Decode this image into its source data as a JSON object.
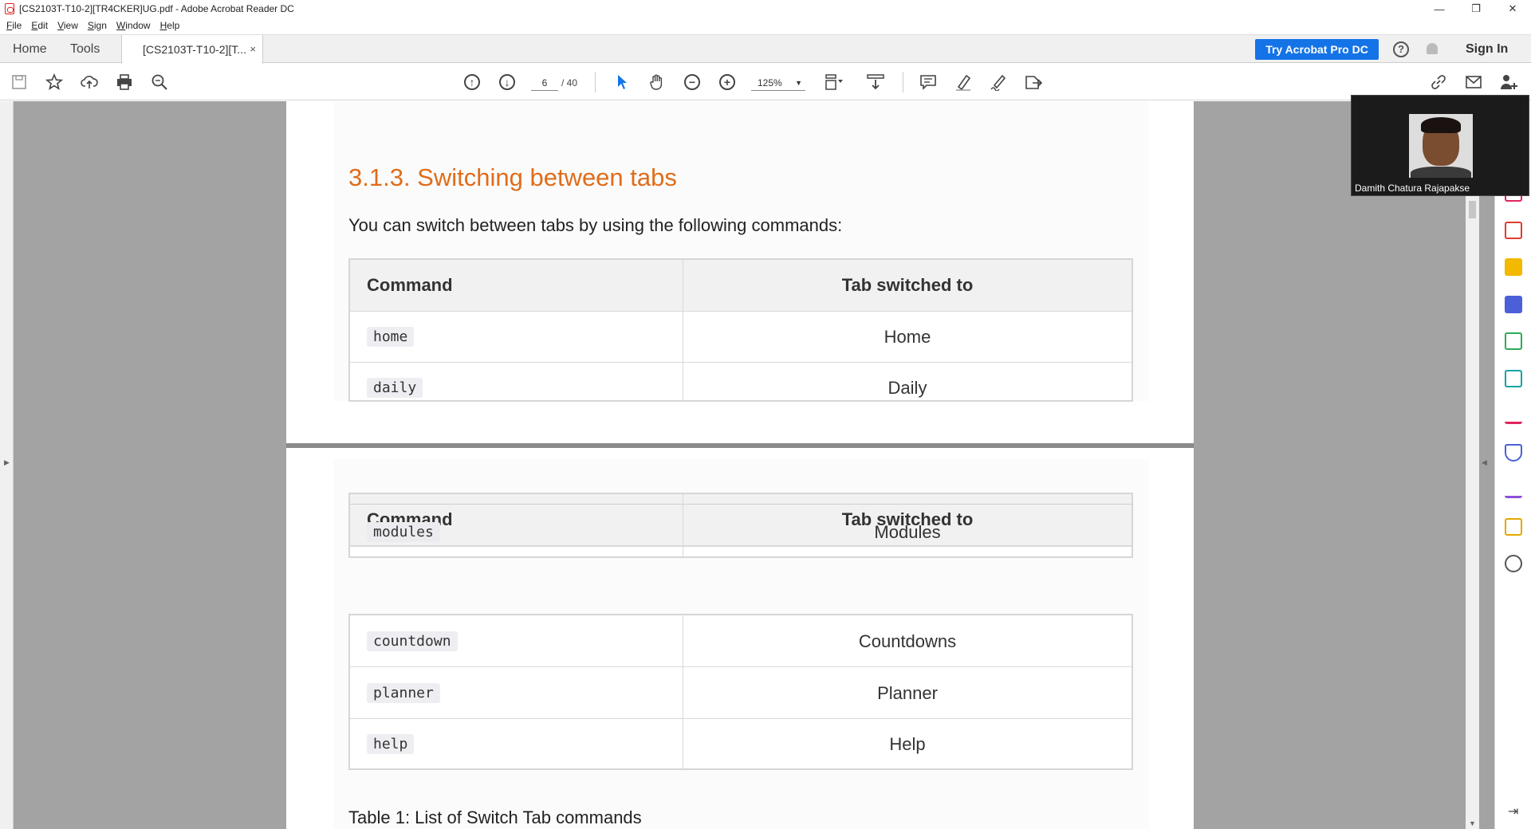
{
  "window": {
    "title": "[CS2103T-T10-2][TR4CKER]UG.pdf - Adobe Acrobat Reader DC",
    "controls": {
      "minimize": "—",
      "restore": "❐",
      "close": "✕"
    }
  },
  "menu": [
    "File",
    "Edit",
    "View",
    "Sign",
    "Window",
    "Help"
  ],
  "tabs": {
    "home": "Home",
    "tools": "Tools",
    "document": "[CS2103T-T10-2][T...",
    "close": "×"
  },
  "header": {
    "try_button": "Try Acrobat Pro DC",
    "help": "?",
    "sign_in": "Sign In"
  },
  "toolbar": {
    "current_page": "6",
    "total_pages": "/ 40",
    "zoom": "125%"
  },
  "document": {
    "heading": "3.1.3. Switching between tabs",
    "intro": "You can switch between tabs by using the following commands:",
    "table_headers": {
      "command": "Command",
      "tab": "Tab switched to"
    },
    "rows_page1": [
      {
        "command": "home",
        "tab": "Home"
      },
      {
        "command": "daily",
        "tab": "Daily"
      }
    ],
    "rows_page2_overlap": {
      "command": "modules",
      "tab": "Modules"
    },
    "rows_page2": [
      {
        "command": "countdown",
        "tab": "Countdowns"
      },
      {
        "command": "planner",
        "tab": "Planner"
      },
      {
        "command": "help",
        "tab": "Help"
      }
    ],
    "caption": "Table 1: List of Switch Tab commands"
  },
  "video": {
    "participant": "Damith Chatura Rajapakse"
  },
  "colors": {
    "accent": "#1473e6",
    "heading": "#e06c1a",
    "workarea": "#a3a3a3"
  }
}
